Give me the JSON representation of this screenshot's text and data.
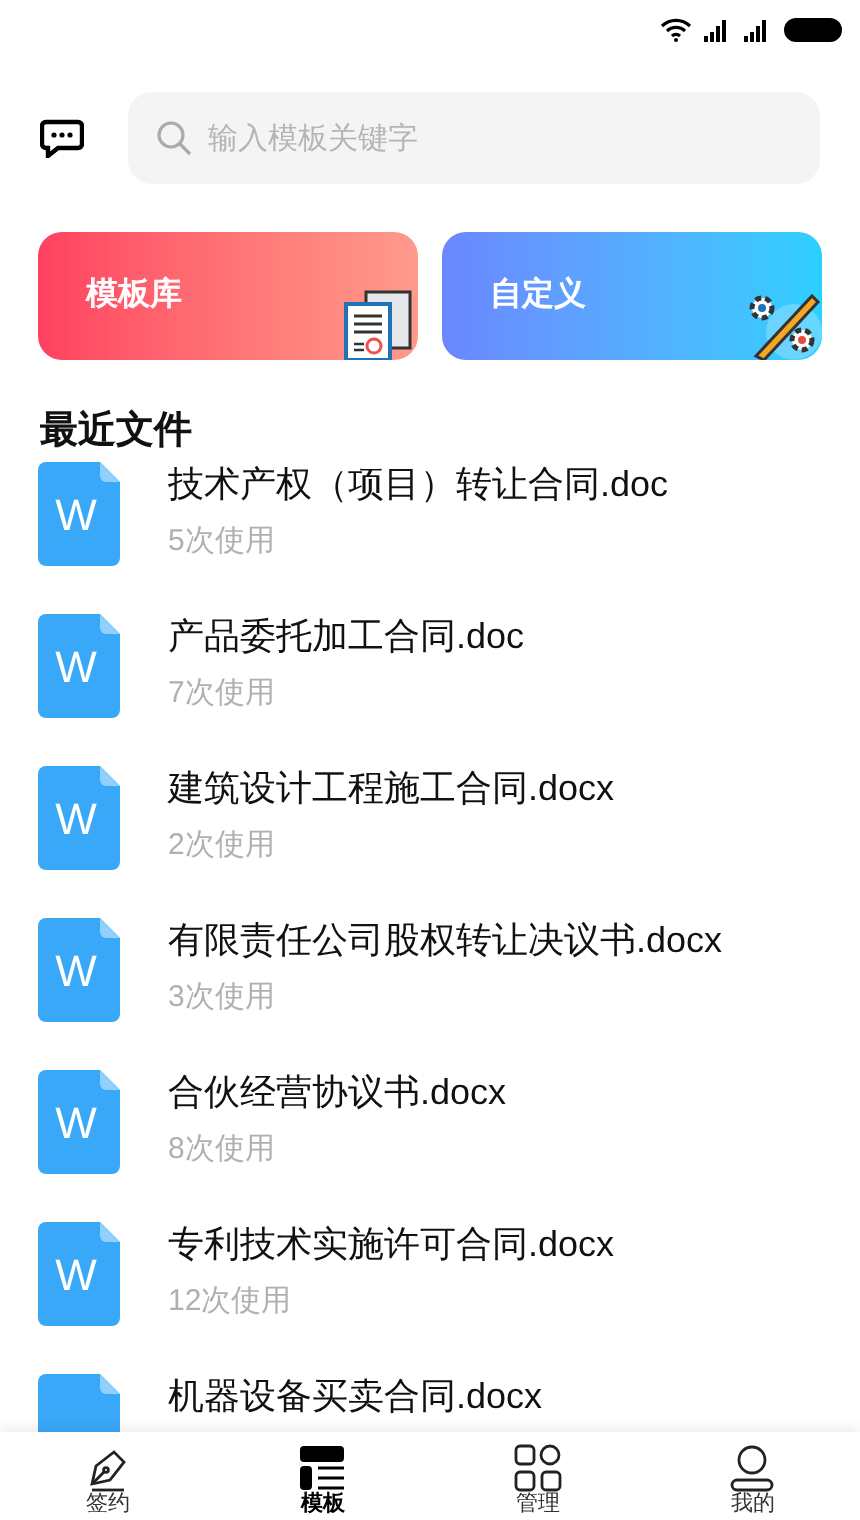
{
  "search": {
    "placeholder": "输入模板关键字"
  },
  "cards": [
    {
      "label": "模板库",
      "kind": "library"
    },
    {
      "label": "自定义",
      "kind": "custom"
    }
  ],
  "section_title": "最近文件",
  "files": [
    {
      "icon": "W",
      "name": "技术产权（项目）转让合同.doc",
      "usage": "5次使用"
    },
    {
      "icon": "W",
      "name": "产品委托加工合同.doc",
      "usage": "7次使用"
    },
    {
      "icon": "W",
      "name": "建筑设计工程施工合同.docx",
      "usage": "2次使用"
    },
    {
      "icon": "W",
      "name": "有限责任公司股权转让决议书.docx",
      "usage": "3次使用"
    },
    {
      "icon": "W",
      "name": "合伙经营协议书.docx",
      "usage": "8次使用"
    },
    {
      "icon": "W",
      "name": "专利技术实施许可合同.docx",
      "usage": "12次使用"
    },
    {
      "name": "机器设备买卖合同.docx"
    }
  ],
  "tabs": [
    {
      "label": "签约",
      "kind": "sign",
      "selected": false
    },
    {
      "label": "模板",
      "kind": "template",
      "selected": true
    },
    {
      "label": "管理",
      "kind": "manage",
      "selected": false
    },
    {
      "label": "我的",
      "kind": "me",
      "selected": false
    }
  ]
}
